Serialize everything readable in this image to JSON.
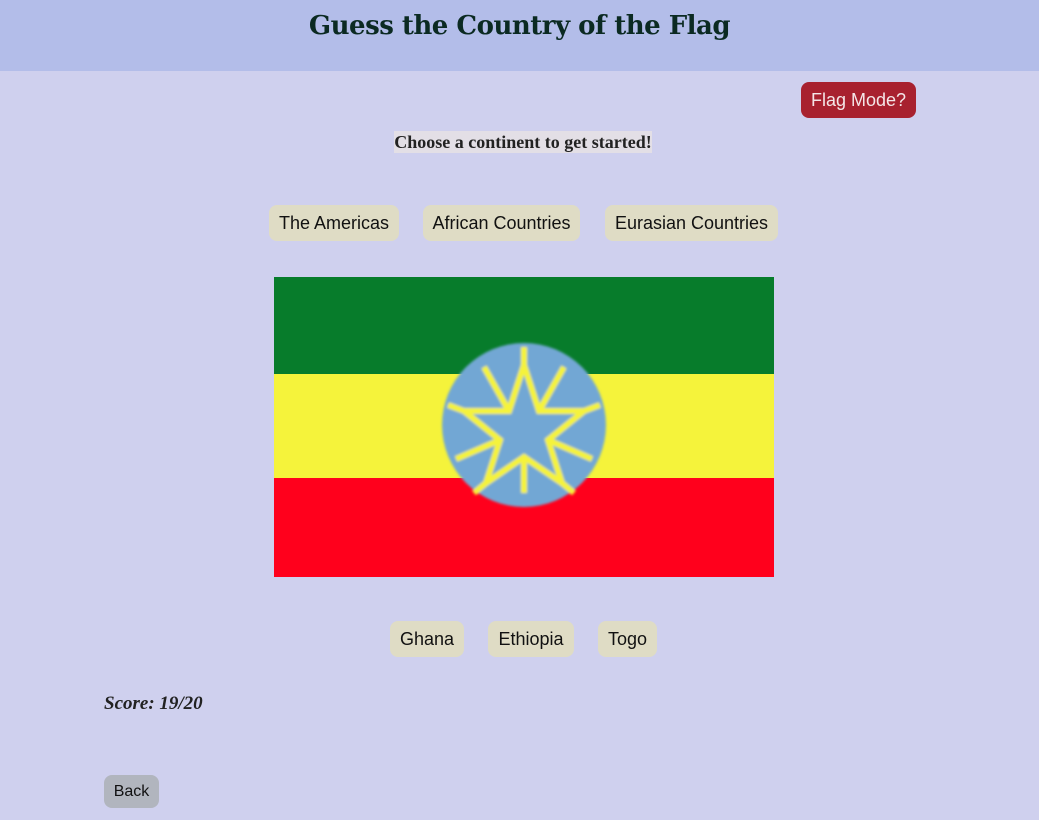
{
  "header": {
    "title": "Guess the Country of the Flag"
  },
  "mode_toggle": {
    "label": "Flag Mode?",
    "color": "#a8212f"
  },
  "prompt": "Choose a continent to get started!",
  "continents": [
    {
      "label": "The Americas"
    },
    {
      "label": "African Countries"
    },
    {
      "label": "Eurasian Countries"
    }
  ],
  "flag": {
    "icon": "ethiopia-flag-icon",
    "colors": {
      "green": "#077c2b",
      "yellow": "#f5f33b",
      "red": "#ff001c",
      "emblem": "#72a7d4"
    }
  },
  "answers": [
    {
      "label": "Ghana"
    },
    {
      "label": "Ethiopia"
    },
    {
      "label": "Togo"
    }
  ],
  "score": {
    "text": "Score: 19/20"
  },
  "back": {
    "label": "Back"
  }
}
